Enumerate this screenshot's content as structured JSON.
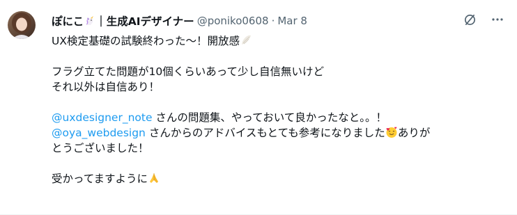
{
  "author": {
    "display_name": "ぽにこ",
    "separator": "｜",
    "title": "生成AIデザイナー",
    "handle": "@poniko0608",
    "dot": "·",
    "date": "Mar 8"
  },
  "icons": {
    "name_badge": "unicorn-emoji",
    "grok": "grok-icon",
    "more": "more-options-icon"
  },
  "tweet": {
    "line1": "UX検定基礎の試験終わった〜！開放感",
    "line2": "フラグ立てた問題が10個くらいあって少し自信無いけど",
    "line3": "それ以外は自信あり！",
    "mention1": "@uxdesigner_note",
    "line4_rest": " さんの問題集、やっておいて良かったなと。。！",
    "mention2": "@oya_webdesign",
    "line5_rest": " さんからのアドバイスもとても参考になりました",
    "line5_end": "ありが",
    "line6": "とうございました！",
    "line7": "受かってますように"
  }
}
